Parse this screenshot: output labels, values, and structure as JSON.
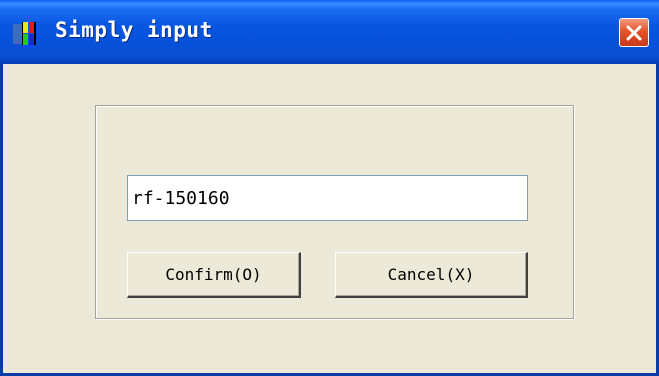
{
  "window": {
    "title": "Simply input",
    "icon": "app-window-icon",
    "close_icon": "close-icon"
  },
  "form": {
    "input_value": "rf-150160",
    "confirm_label": "Confirm(O)",
    "cancel_label": "Cancel(X)"
  },
  "colors": {
    "titlebar": "#0A5FF2",
    "close_button": "#E6522B",
    "dialog_background": "#ECE9D8"
  }
}
